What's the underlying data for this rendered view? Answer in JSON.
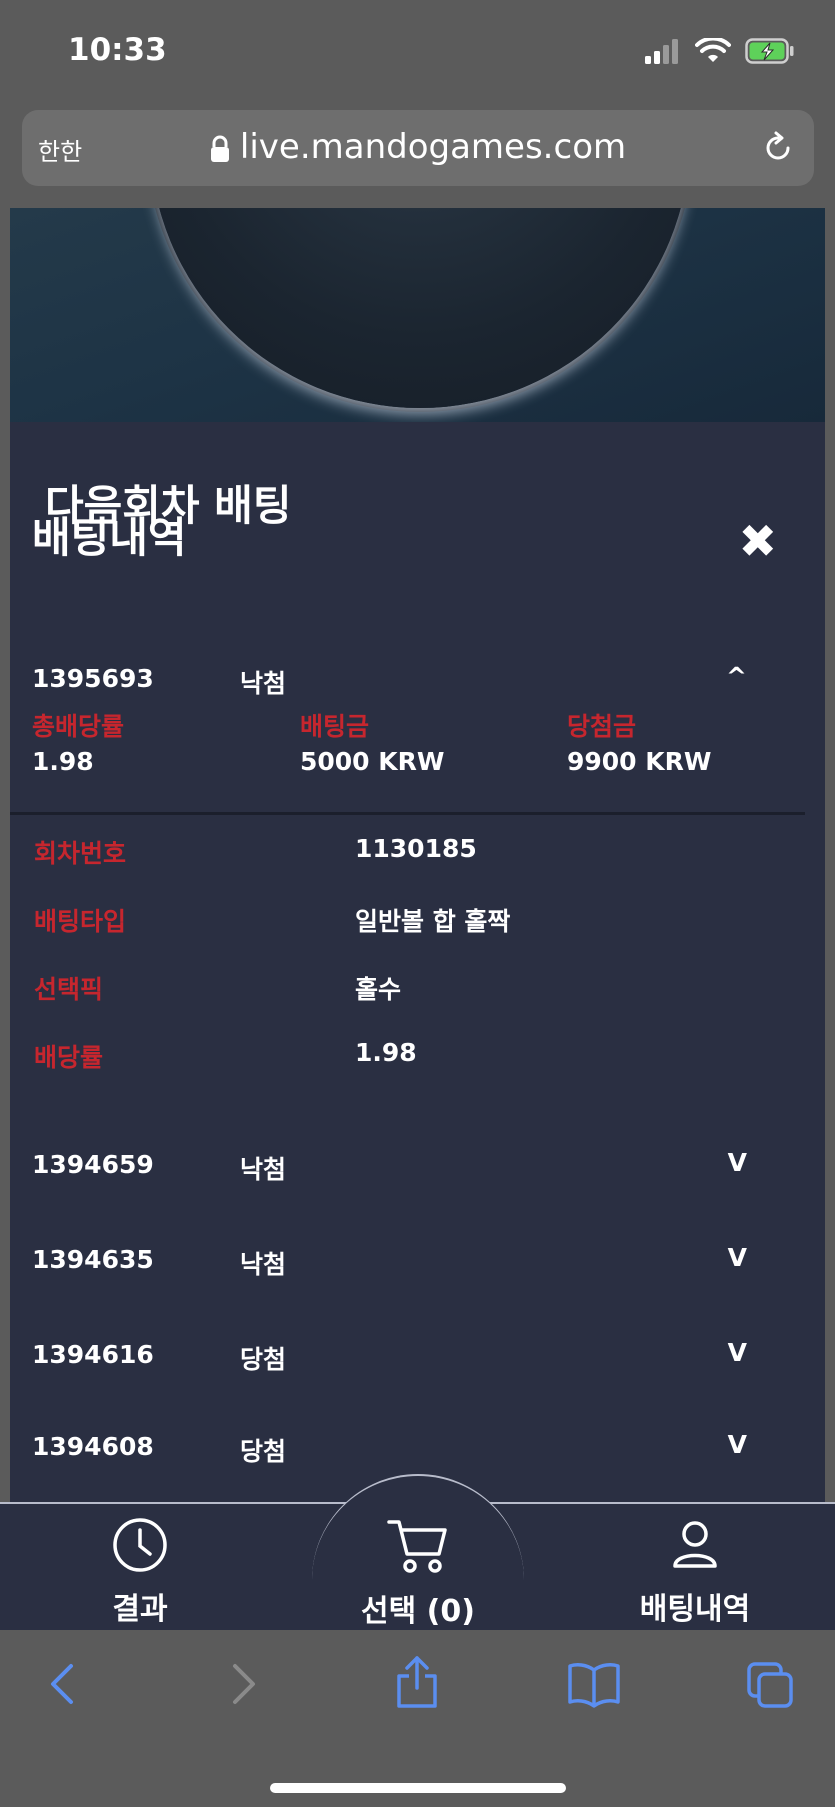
{
  "status": {
    "time": "10:33"
  },
  "browser": {
    "text_size": "한한",
    "url": "live.mandogames.com"
  },
  "modal": {
    "ghost_title": "다음회차 배팅",
    "title": "배팅내역",
    "close_label": "✖",
    "expanded": {
      "id": "1395693",
      "result": "낙첨",
      "toggle": "^",
      "summary": {
        "total_odds_label": "총배당률",
        "total_odds_value": "1.98",
        "bet_amount_label": "배팅금",
        "bet_amount_value": "5000 KRW",
        "win_amount_label": "당첨금",
        "win_amount_value": "9900 KRW"
      },
      "details": [
        {
          "label": "회차번호",
          "value": "1130185"
        },
        {
          "label": "배팅타입",
          "value": "일반볼 합 홀짝"
        },
        {
          "label": "선택픽",
          "value": "홀수"
        },
        {
          "label": "배당률",
          "value": "1.98"
        }
      ]
    },
    "rows": [
      {
        "id": "1394659",
        "result": "낙첨",
        "toggle": "V"
      },
      {
        "id": "1394635",
        "result": "낙첨",
        "toggle": "V"
      },
      {
        "id": "1394616",
        "result": "당첨",
        "toggle": "V"
      },
      {
        "id": "1394608",
        "result": "당첨",
        "toggle": "V"
      }
    ]
  },
  "tabbar": {
    "results": "결과",
    "selection": "선택 (0)",
    "history": "배팅내역"
  },
  "icons": {
    "results": "clock-icon",
    "selection": "cart-icon",
    "history": "user-icon",
    "back": "back-arrow-icon",
    "forward": "forward-arrow-icon",
    "share": "share-icon",
    "bookmarks": "book-icon",
    "tabs": "tabs-icon"
  },
  "colors": {
    "accent_red": "#c6262e",
    "panel": "#2a2f42",
    "safari_blue": "#5b8ef0"
  }
}
